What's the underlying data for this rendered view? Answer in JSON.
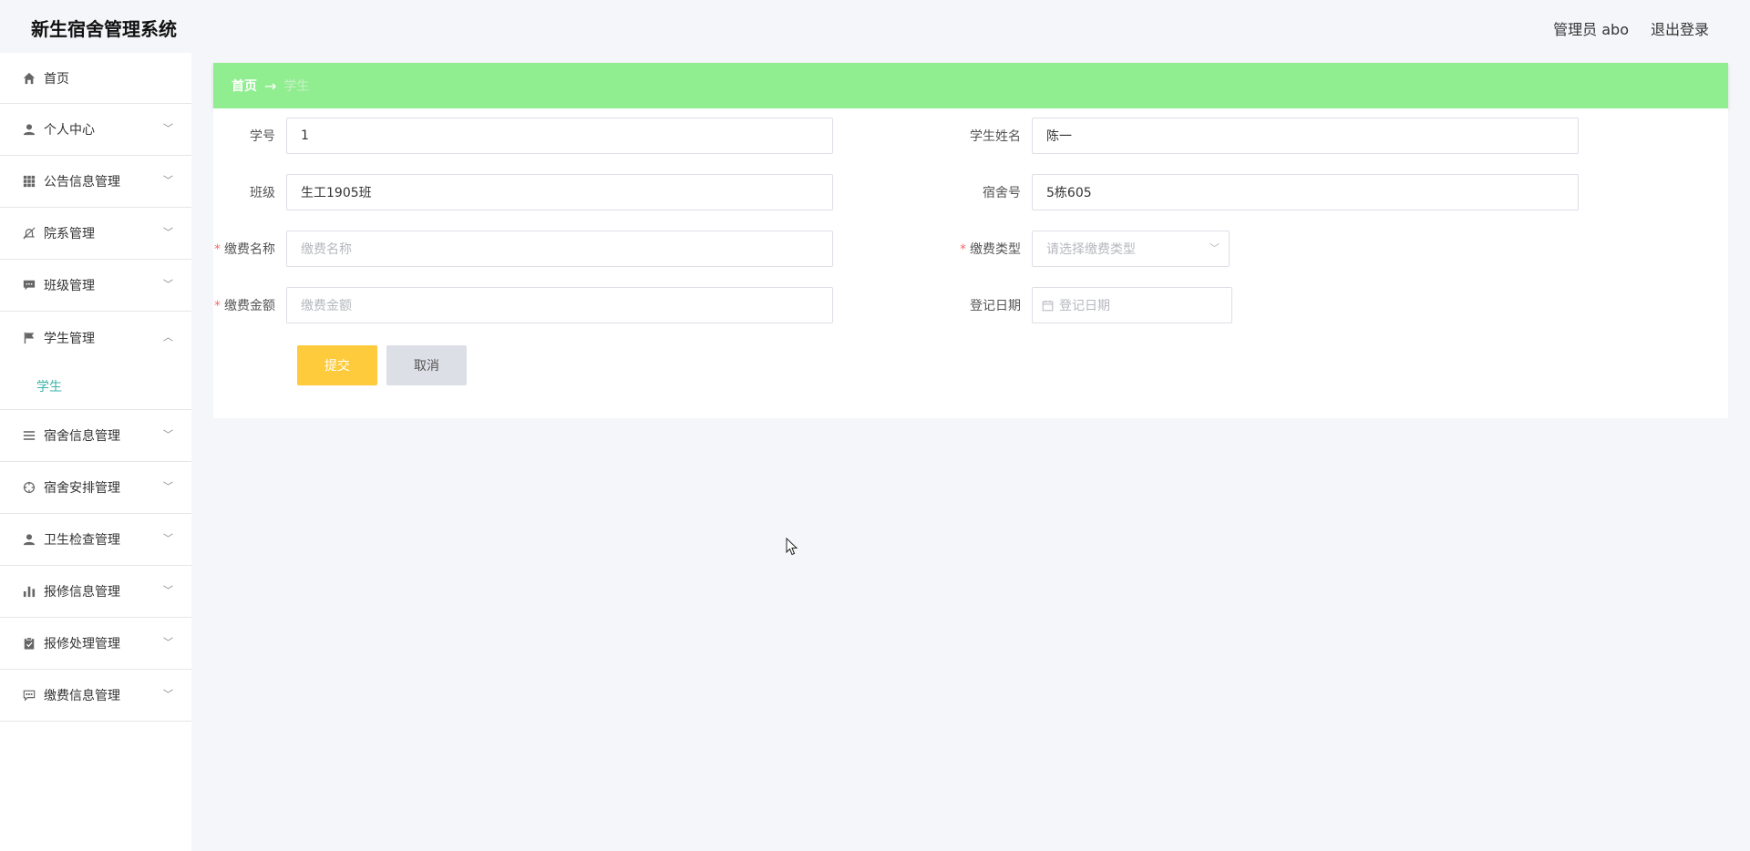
{
  "header": {
    "title": "新生宿舍管理系统",
    "user_label": "管理员 abo",
    "logout_label": "退出登录"
  },
  "sidebar": {
    "items": [
      {
        "label": "首页",
        "icon": "home-icon"
      },
      {
        "label": "个人中心",
        "icon": "user-icon"
      },
      {
        "label": "公告信息管理",
        "icon": "grid-icon"
      },
      {
        "label": "院系管理",
        "icon": "bell-off-icon"
      },
      {
        "label": "班级管理",
        "icon": "chat-icon"
      },
      {
        "label": "学生管理",
        "icon": "flag-icon",
        "expanded": true,
        "children": [
          {
            "label": "学生"
          }
        ]
      },
      {
        "label": "宿舍信息管理",
        "icon": "menu-icon"
      },
      {
        "label": "宿舍安排管理",
        "icon": "crosshair-icon"
      },
      {
        "label": "卫生检查管理",
        "icon": "user-icon"
      },
      {
        "label": "报修信息管理",
        "icon": "bar-chart-icon"
      },
      {
        "label": "报修处理管理",
        "icon": "clipboard-icon"
      },
      {
        "label": "缴费信息管理",
        "icon": "comment-icon"
      }
    ],
    "active_color": "#3cb4a8"
  },
  "breadcrumb": {
    "home": "首页",
    "separator": "→",
    "current": "学生",
    "bg_color": "#90ee90"
  },
  "form": {
    "student_id": {
      "label": "学号",
      "value": "1"
    },
    "student_name": {
      "label": "学生姓名",
      "value": "陈一"
    },
    "class_name": {
      "label": "班级",
      "value": "生工1905班"
    },
    "dorm_no": {
      "label": "宿舍号",
      "value": "5栋605"
    },
    "fee_name": {
      "label": "缴费名称",
      "placeholder": "缴费名称",
      "required": true
    },
    "fee_type": {
      "label": "缴费类型",
      "placeholder": "请选择缴费类型",
      "required": true
    },
    "fee_amount": {
      "label": "缴费金额",
      "placeholder": "缴费金额",
      "required": true
    },
    "register_date": {
      "label": "登记日期",
      "placeholder": "登记日期"
    },
    "required_mark": "*",
    "submit_label": "提交",
    "cancel_label": "取消",
    "submit_color": "#fdcb3b"
  }
}
